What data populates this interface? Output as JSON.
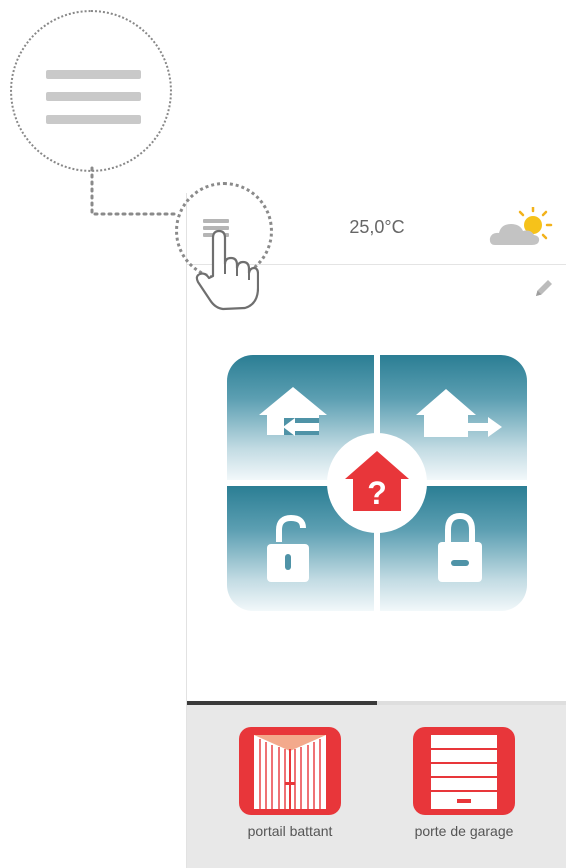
{
  "header": {
    "temperature": "25,0°C",
    "weather_icon": "partly-sunny-icon",
    "menu_icon": "hamburger-menu-icon"
  },
  "tool": {
    "edit_icon": "pencil-icon"
  },
  "security_modes": {
    "top_left": "arrive-home-icon",
    "top_right": "leave-home-icon",
    "bottom_left": "unlocked-padlock-icon",
    "bottom_right": "locked-padlock-icon",
    "center_status": "unknown-status-home-icon",
    "center_glyph": "?"
  },
  "devices": [
    {
      "label": "portail battant",
      "icon": "swing-gate-icon"
    },
    {
      "label": "porte de garage",
      "icon": "garage-door-icon"
    }
  ],
  "colors": {
    "accent_red": "#e8363a",
    "panel_teal": "#2b7e94",
    "devices_bg": "#e8e8e8"
  }
}
